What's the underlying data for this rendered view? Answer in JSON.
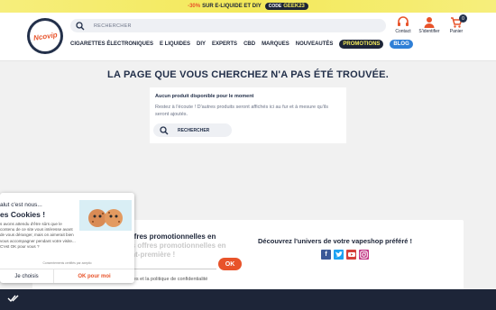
{
  "promo": {
    "percent": "-30%",
    "text": "SUR E-LIQUIDE ET DIY",
    "code_label": "CODE",
    "code": "GEEK23"
  },
  "brand": {
    "logo_text": "Ncovip"
  },
  "search": {
    "placeholder": "RECHERCHER"
  },
  "account": {
    "contact": "Contact",
    "login": "S'identifier",
    "cart": "Panier",
    "cart_count": "0"
  },
  "nav": {
    "items": [
      "CIGARETTES ÉLECTRONIQUES",
      "E LIQUIDES",
      "DIY",
      "EXPERTS",
      "CBD",
      "MARQUES",
      "NOUVEAUTÉS"
    ],
    "promotions": "PROMOTIONS",
    "blog": "BLOG"
  },
  "page": {
    "title": "LA PAGE QUE VOUS CHERCHEZ N'A PAS ÉTÉ TROUVÉE."
  },
  "empty": {
    "heading": "Aucun produit disponible pour le moment",
    "text": "Restez à l'écoute ! D'autres produits seront affichés ici au fur et à mesure qu'ils seront ajoutés.",
    "search_placeholder": "RECHERCHER"
  },
  "newsletter": {
    "title": "ffres promotionnelles en",
    "ghost": "Recevez toutes nos offres promotionnelles en avant-première !",
    "ok": "OK",
    "legal": "J'accepte les conditions générales et la politique de confidentialité"
  },
  "social": {
    "title": "Découvrez l'univers de votre vapeshop préféré !"
  },
  "cookie": {
    "greeting": "alut c'est nous...",
    "title": "es Cookies !",
    "body": "s avons attendu d'être sûrs que le contenu de ce site vous intéresse avant de vous déranger, mais on aimerait bien vous accompagner pendant votre visite... C'est OK pour vous ?",
    "small": "Consentements certifiés par axeptio",
    "refuse": "Je choisis",
    "accept": "OK pour moi"
  },
  "colors": {
    "navy": "#1d2538",
    "accent": "#e8532a",
    "yellow": "#f3e95a",
    "blog": "#2f7fd6"
  }
}
